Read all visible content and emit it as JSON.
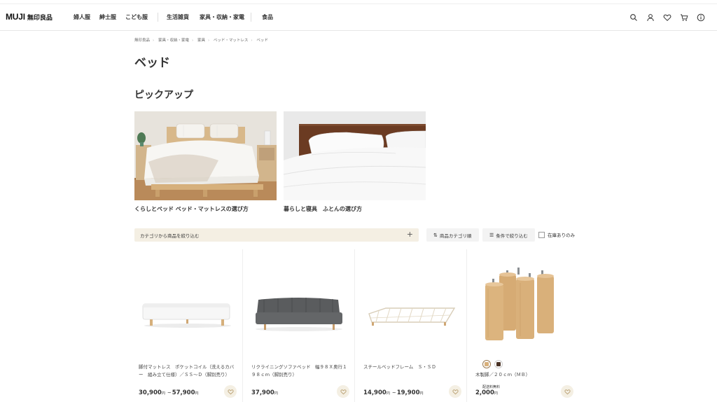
{
  "header": {
    "logo_text": "MUJI",
    "logo_sub": "無印良品",
    "nav": [
      "婦人服",
      "紳士服",
      "こども服",
      "生活雑貨",
      "家具・収納・家電",
      "食品"
    ]
  },
  "breadcrumb": [
    "無印良品",
    "家具・収納・家電",
    "家具",
    "ベッド・マットレス",
    "ベッド"
  ],
  "page_title": "ベッド",
  "pickup": {
    "title": "ピックアップ",
    "items": [
      {
        "caption": "くらしとベッド ベッド・マットレスの選び方"
      },
      {
        "caption": "暮らしと寝具　ふとんの選び方"
      }
    ]
  },
  "filters": {
    "category_label": "カテゴリから商品を絞り込む",
    "sort_label": "商品カテゴリ順",
    "condition_label": "条件で絞り込む",
    "stock_label": "在庫ありのみ"
  },
  "products": [
    {
      "name": "脚付マットレス　ポケットコイル（洗えるカバー　組み立て仕様）／ＳＳ～Ｄ（脚別売り）",
      "price_from": "30,900",
      "price_to": "57,900",
      "yen": "円"
    },
    {
      "name": "リクライニングソファベッド　幅９８Ｘ奥行１９８ｃｍ（脚別売り）",
      "price_from": "37,900",
      "yen": "円"
    },
    {
      "name": "スチールベッドフレーム　Ｓ・ＳＤ",
      "price_from": "14,900",
      "price_to": "19,900",
      "yen": "円"
    },
    {
      "name": "木製脚／２０ｃｍ（ＭＢ）",
      "badge": "配送料無料",
      "price_from": "2,000",
      "yen": "円"
    }
  ],
  "colors": {
    "accent_beige": "#f4efe3",
    "wood": "#d9b07a"
  }
}
